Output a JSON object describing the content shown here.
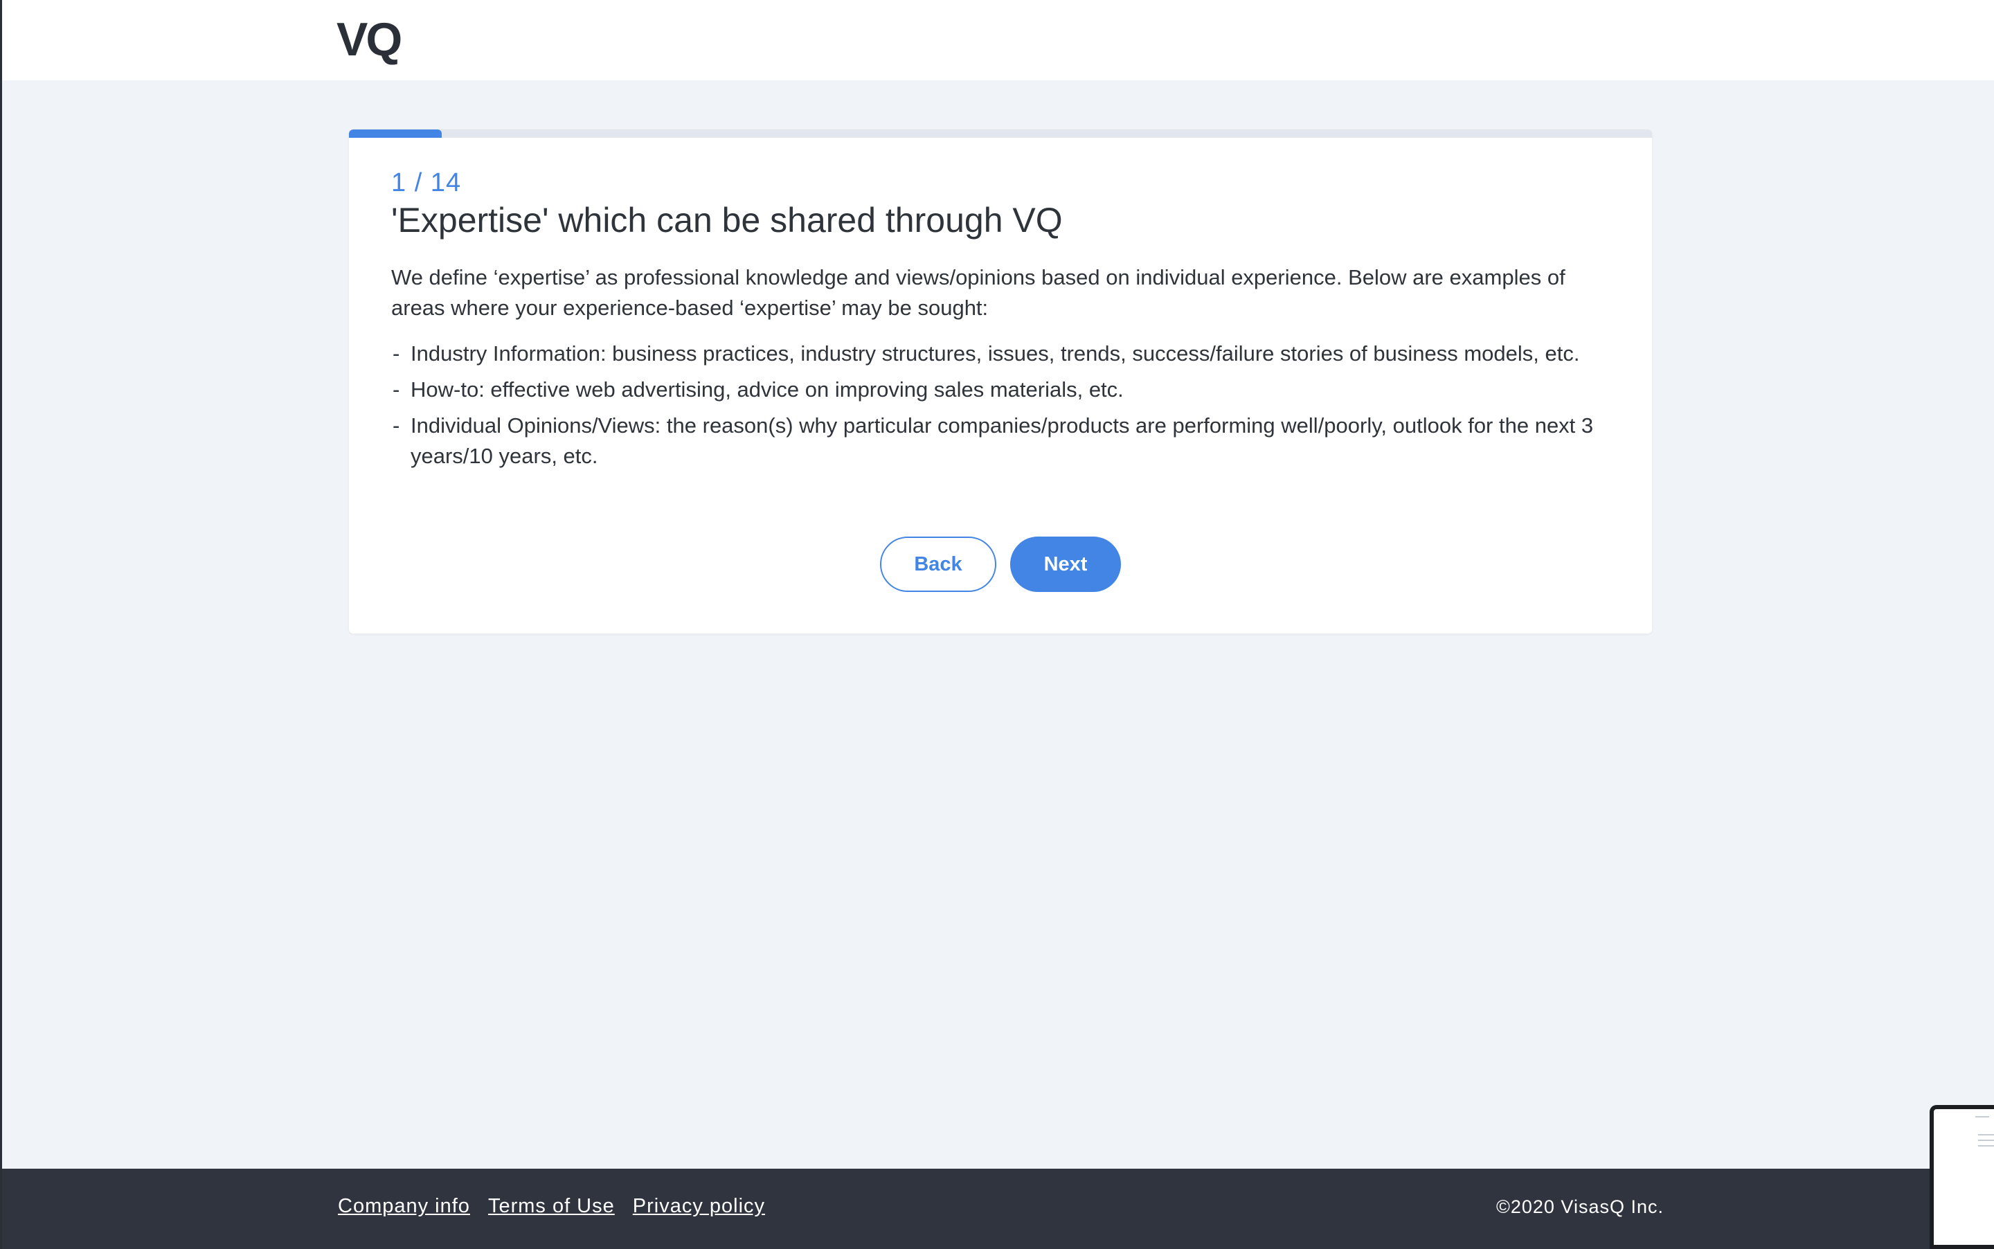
{
  "header": {
    "logo": "VQ"
  },
  "progress": {
    "current": 1,
    "total": 14,
    "fraction": 0.0714,
    "step_label": "1 / 14"
  },
  "card": {
    "title": "'Expertise' which can be shared through VQ",
    "intro": "We define ‘expertise’ as professional knowledge and views/opinions based on individual experience. Below are examples of areas where your experience-based ‘expertise’ may be sought:",
    "items": [
      {
        "dash": "-",
        "text": "Industry Information: business practices, industry structures, issues, trends, success/failure stories of business models, etc."
      },
      {
        "dash": "-",
        "text": "How-to: effective web advertising, advice on improving sales materials, etc."
      },
      {
        "dash": "-",
        "text": "Individual Opinions/Views: the reason(s) why particular companies/products are performing well/poorly, outlook for the next 3 years/10 years, etc."
      }
    ],
    "back_label": "Back",
    "next_label": "Next"
  },
  "footer": {
    "links": [
      "Company info",
      "Terms of Use",
      "Privacy policy"
    ],
    "copyright": "©2020 VisasQ Inc."
  },
  "colors": {
    "accent": "#4285e4",
    "footer_bg": "#30343e",
    "page_bg": "#f0f3f7"
  }
}
